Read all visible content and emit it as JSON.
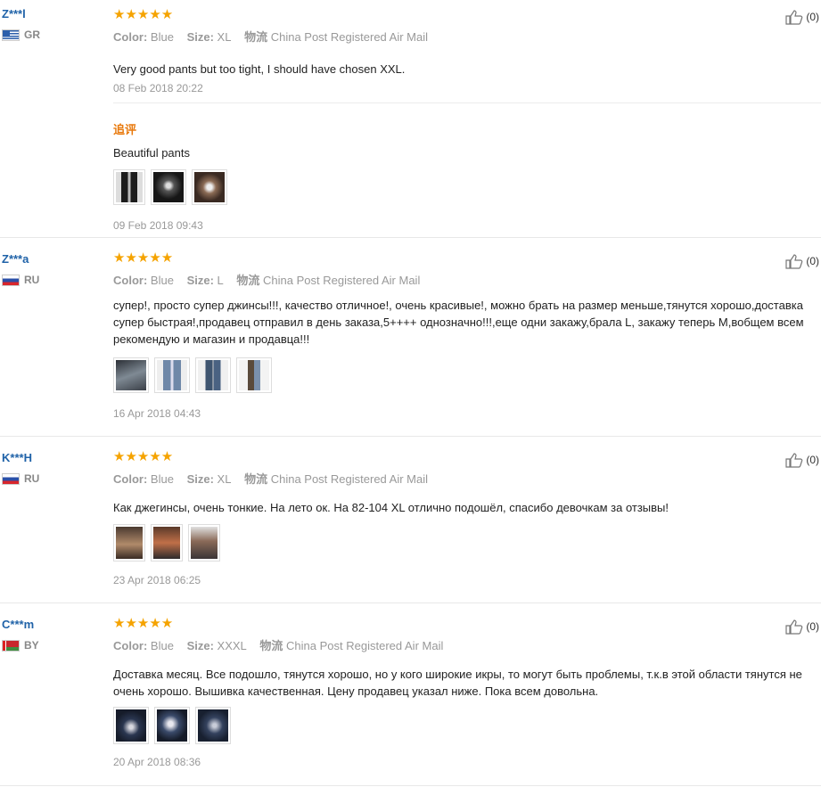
{
  "labels": {
    "color": "Color:",
    "size": "Size:",
    "shipping": "物流",
    "followup": "追评"
  },
  "stars_text": "★★★★★",
  "colors": {
    "star": "#f5a300",
    "username": "#1f62a8",
    "followup": "#e8790c"
  },
  "reviews": [
    {
      "user": "Z***l",
      "country": "GR",
      "flag_icon": "greece-flag-icon",
      "rating": 5,
      "color": "Blue",
      "size": "XL",
      "shipping": "China Post Registered Air Mail",
      "text": "Very good pants but too tight, I should have chosen XXL.",
      "date": "08 Feb 2018 20:22",
      "helpful": "(0)",
      "followup": {
        "text": "Beautiful pants",
        "date": "09 Feb 2018 09:43",
        "images": [
          "dark-jeans-photo",
          "embroidery-photo",
          "embroidery-closeup-photo"
        ]
      }
    },
    {
      "user": "Z***a",
      "country": "RU",
      "flag_icon": "russia-flag-icon",
      "rating": 5,
      "color": "Blue",
      "size": "L",
      "shipping": "China Post Registered Air Mail",
      "text": "супер!, просто супер джинсы!!!, качество отличное!, очень красивые!, можно брать на размер меньше,тянутся хорошо,доставка супер быстрая!,продавец отправил в день заказа,5++++ однозначно!!!,еще одни закажу,брала L, закажу теперь M,вобщем всем рекомендую и магазин и продавца!!!",
      "date": "16 Apr 2018 04:43",
      "helpful": "(0)",
      "images": [
        "jeans-photo-1",
        "jeans-photo-2",
        "jeans-photo-3",
        "jeans-photo-4"
      ]
    },
    {
      "user": "K***H",
      "country": "RU",
      "flag_icon": "russia-flag-icon",
      "rating": 5,
      "color": "Blue",
      "size": "XL",
      "shipping": "China Post Registered Air Mail",
      "text": "Как джегинсы, очень тонкие. На лето ок. На 82-104 XL отлично подошёл, спасибо девочкам за отзывы!",
      "date": "23 Apr 2018 06:25",
      "helpful": "(0)",
      "images": [
        "mirror-photo-1",
        "mirror-photo-2",
        "mirror-photo-3"
      ]
    },
    {
      "user": "C***m",
      "country": "BY",
      "flag_icon": "belarus-flag-icon",
      "rating": 5,
      "color": "Blue",
      "size": "XXXL",
      "shipping": "China Post Registered Air Mail",
      "text": "Доставка месяц. Все подошло, тянутся хорошо, но у кого широкие икры, то могут быть проблемы, т.к.в этой области тянутся не очень хорошо. Вышивка качественная. Цену продавец указал ниже. Пока всем довольна.",
      "date": "20 Apr 2018 08:36",
      "helpful": "(0)",
      "images": [
        "embroidered-jeans-photo-1",
        "embroidered-jeans-photo-2",
        "embroidered-jeans-photo-3"
      ]
    }
  ]
}
